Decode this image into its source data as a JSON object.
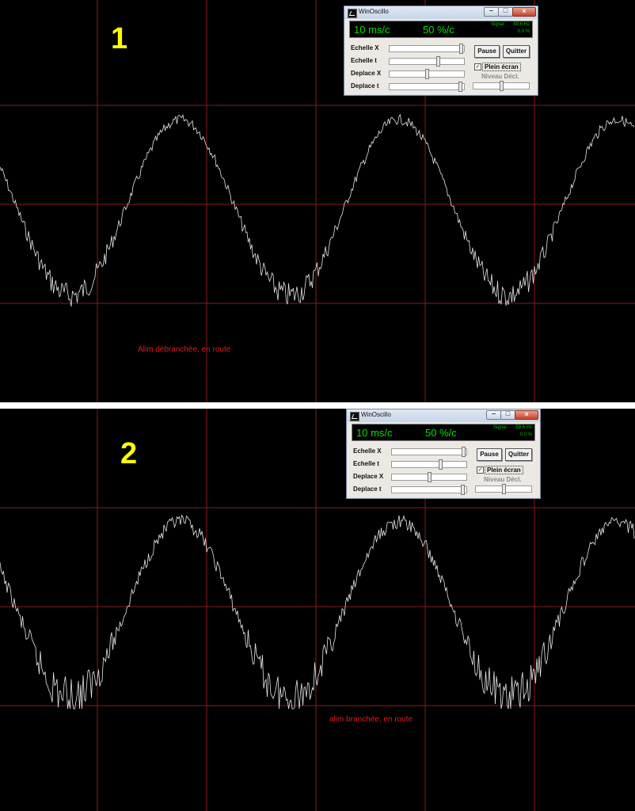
{
  "panels": [
    {
      "number": "1",
      "caption": "Alim débranchée, en route",
      "window": {
        "title": "WinOscillo",
        "time_scale": "10 ms/c",
        "volt_scale": "50 %/c",
        "signal_label": "Signal",
        "freq": "59.6 Hz",
        "level": "0.0 %",
        "sliders": [
          {
            "label": "Echelle X",
            "value": 0.98
          },
          {
            "label": "Echelle t",
            "value": 0.66
          },
          {
            "label": "Deplace X",
            "value": 0.5
          },
          {
            "label": "Deplace t",
            "value": 0.97
          }
        ],
        "pause_label": "Pause",
        "quit_label": "Quitter",
        "fullscreen_label": "Plein écran",
        "fullscreen_checked": true,
        "trigger_label": "Niveau Décl.",
        "trigger_value": 0.5
      },
      "signal": {
        "noise": 0.55,
        "frequency_hz": 59.6
      }
    },
    {
      "number": "2",
      "caption": "alim branchée, en route",
      "window": {
        "title": "WinOscillo",
        "time_scale": "10 ms/c",
        "volt_scale": "50 %/c",
        "signal_label": "Signal",
        "freq": "59.6 Hz",
        "level": "0.0 %",
        "sliders": [
          {
            "label": "Echelle X",
            "value": 0.98
          },
          {
            "label": "Echelle t",
            "value": 0.66
          },
          {
            "label": "Deplace X",
            "value": 0.5
          },
          {
            "label": "Deplace t",
            "value": 0.97
          }
        ],
        "pause_label": "Pause",
        "quit_label": "Quitter",
        "fullscreen_label": "Plein écran",
        "fullscreen_checked": true,
        "trigger_label": "Niveau Décl.",
        "trigger_value": 0.5
      },
      "signal": {
        "noise": 1.0,
        "frequency_hz": 59.6
      }
    }
  ],
  "colors": {
    "background": "#000000",
    "grid": "#8b1a1a",
    "trace": "#e6e6e6",
    "number": "#ffff00",
    "caption": "#e21b1b",
    "display_text": "#00e000"
  }
}
